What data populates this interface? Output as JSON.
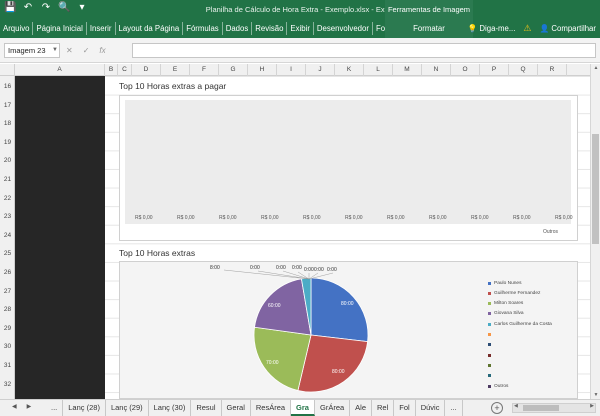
{
  "title_bar": {
    "document_title": "Planilha de Cálculo de Hora Extra - Exemplo.xlsx - Excel",
    "tools_header": "Ferramentas de Imagem",
    "qat_icons": [
      "save-icon",
      "undo-icon",
      "redo-icon",
      "print-preview-icon",
      "customize-icon"
    ]
  },
  "ribbon": {
    "tabs": [
      "Arquivo",
      "Página Inicial",
      "Inserir",
      "Layout da Página",
      "Fórmulas",
      "Dados",
      "Revisão",
      "Exibir",
      "Desenvolvedor",
      "Foxit PDF"
    ],
    "contextual_tab": "Formatar",
    "tell_me": "Diga-me...",
    "share": "Compartilhar"
  },
  "formula_bar": {
    "name_box": "Imagem 23",
    "cancel": "✕",
    "enter": "✓",
    "fx": "fx",
    "formula": ""
  },
  "columns": [
    "A",
    "B",
    "C",
    "D",
    "E",
    "F",
    "G",
    "H",
    "I",
    "J",
    "K",
    "L",
    "M",
    "N",
    "O",
    "P",
    "Q",
    "R"
  ],
  "rows": [
    "16",
    "17",
    "18",
    "19",
    "20",
    "21",
    "22",
    "23",
    "24",
    "25",
    "26",
    "27",
    "28",
    "29",
    "30",
    "31",
    "32"
  ],
  "chart1": {
    "title": "Top 10 Horas extras a pagar",
    "bar_labels": [
      "R$ 0,00",
      "R$ 0,00",
      "R$ 0,00",
      "R$ 0,00",
      "R$ 0,00",
      "R$ 0,00",
      "R$ 0,00",
      "R$ 0,00",
      "R$ 0,00",
      "R$ 0,00",
      "R$ 0,00"
    ],
    "axis_category": "Outros"
  },
  "chart2": {
    "title": "Top 10 Horas extras",
    "slice_labels": [
      "80:00",
      "80:00",
      "70:00",
      "60:00"
    ],
    "zero_labels": [
      "0:00",
      "0:00",
      "0:00",
      "0:00",
      "0:00",
      "0:00"
    ],
    "outer_label": "8:00",
    "legend": [
      {
        "label": "Paulo Nunes",
        "color": "#4472c4"
      },
      {
        "label": "Guilherme Fernandez",
        "color": "#c0504d"
      },
      {
        "label": "Milton Soares",
        "color": "#9bbb59"
      },
      {
        "label": "Giovana Silva",
        "color": "#8064a2"
      },
      {
        "label": "Carlos Guilherme da Costa",
        "color": "#4bacc6"
      },
      {
        "label": "",
        "color": "#f79646"
      },
      {
        "label": "",
        "color": "#2c4d75"
      },
      {
        "label": "",
        "color": "#772c2a"
      },
      {
        "label": "",
        "color": "#5f7530"
      },
      {
        "label": "",
        "color": "#276a7c"
      },
      {
        "label": "Outros",
        "color": "#4d3b62"
      }
    ]
  },
  "chart_data": [
    {
      "type": "bar",
      "title": "Top 10 Horas extras a pagar",
      "categories": [
        "",
        "",
        "",
        "",
        "",
        "",
        "",
        "",
        "",
        "",
        "Outros"
      ],
      "values": [
        0,
        0,
        0,
        0,
        0,
        0,
        0,
        0,
        0,
        0,
        0
      ],
      "data_labels": [
        "R$ 0,00",
        "R$ 0,00",
        "R$ 0,00",
        "R$ 0,00",
        "R$ 0,00",
        "R$ 0,00",
        "R$ 0,00",
        "R$ 0,00",
        "R$ 0,00",
        "R$ 0,00",
        "R$ 0,00"
      ]
    },
    {
      "type": "pie",
      "title": "Top 10 Horas extras",
      "categories": [
        "Paulo Nunes",
        "Guilherme Fernandez",
        "Milton Soares",
        "Giovana Silva",
        "Carlos Guilherme da Costa",
        "",
        "",
        "",
        "",
        "",
        "Outros"
      ],
      "values": [
        80,
        80,
        70,
        60,
        8,
        0,
        0,
        0,
        0,
        0,
        0
      ],
      "legend_position": "right"
    }
  ],
  "sheet_tabs": {
    "more_left": "...",
    "tabs": [
      "Lanç (28)",
      "Lanç (29)",
      "Lanç (30)",
      "Resul",
      "Geral",
      "ResÁrea",
      "Gra",
      "GrÁrea",
      "Ale",
      "Rel",
      "Fol",
      "Dúvic",
      "..."
    ],
    "active": "Gra",
    "add": "+"
  }
}
